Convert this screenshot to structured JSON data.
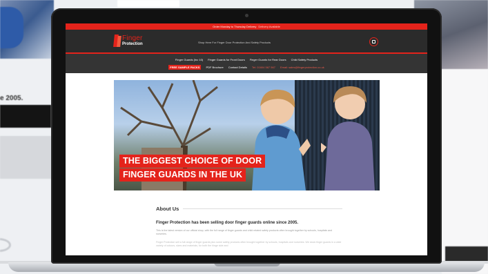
{
  "background": {
    "left_text": "e 2005."
  },
  "site": {
    "promo_bar": {
      "text": "Order Monday to Thursday Delivery",
      "link": "Delivery Available"
    },
    "logo": {
      "name": "Finger",
      "sub": "Protection"
    },
    "tagline": "Shop Here For Finger Door Protection And Safety Products",
    "cart_icon": "shopping-bag-icon",
    "nav": {
      "primary": [
        "Finger Guards (Inc 10)",
        "Finger Guards for Front Doors",
        "Finger Guards for Rear Doors",
        "Child Safety Products"
      ],
      "secondary": {
        "sample": "FREE SAMPLE PACKS",
        "brochure": "PDF Brochure",
        "contact_details": "Contact Details",
        "phone": "Tel: 01604 567 567",
        "email": "Email: sales@fingerprotection.co.uk"
      }
    },
    "hero": {
      "line1": "THE BIGGEST CHOICE OF DOOR",
      "line2": "FINGER GUARDS IN THE UK"
    },
    "about": {
      "heading": "About Us",
      "title": "Finger Protection has been selling door finger guards online since 2005.",
      "p1": "This is the latest version of our official shop, with the full range of finger guards and child related safety products often brought together by schools, hospitals and nurseries.",
      "p2": "Finger Protection sell a full range of finger guards plus some safety products often brought together by schools, hospitals and nurseries. We stock finger guards in a wide variety of colours, sizes and materials, for both the hinge side and"
    },
    "colors": {
      "brand_red": "#e4231b",
      "header_dark": "#2b2b2b",
      "nav_dark": "#343434"
    }
  }
}
